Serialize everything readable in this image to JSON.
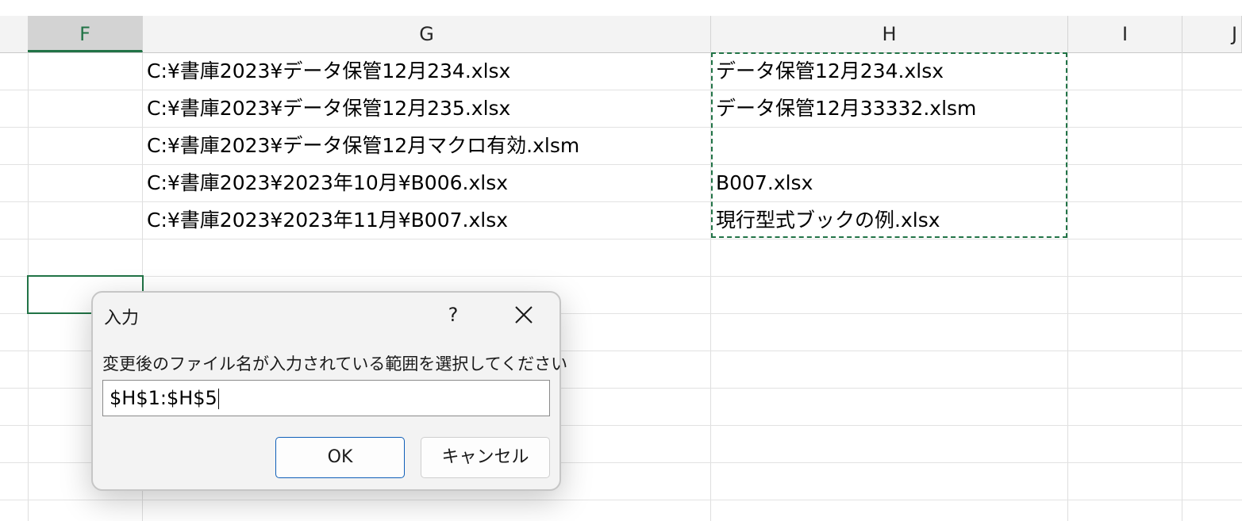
{
  "columns": [
    {
      "label": "F"
    },
    {
      "label": "G"
    },
    {
      "label": "H"
    },
    {
      "label": "I"
    },
    {
      "label": "J"
    }
  ],
  "cells": {
    "g": [
      "C:¥書庫2023¥データ保管12月234.xlsx",
      "C:¥書庫2023¥データ保管12月235.xlsx",
      "C:¥書庫2023¥データ保管12月マクロ有効.xlsm",
      "C:¥書庫2023¥2023年10月¥B006.xlsx",
      "C:¥書庫2023¥2023年11月¥B007.xlsx"
    ],
    "h": [
      "データ保管12月234.xlsx",
      "データ保管12月33332.xlsm",
      "",
      "B007.xlsx",
      "現行型式ブックの例.xlsx"
    ]
  },
  "dialog": {
    "title": "入力",
    "help": "?",
    "prompt": "変更後のファイル名が入力されている範囲を選択してください",
    "input_value": "$H$1:$H$5",
    "ok_label": "OK",
    "cancel_label": "キャンセル"
  },
  "colors": {
    "accent": "#217346",
    "ok_border": "#0f5fb8"
  }
}
